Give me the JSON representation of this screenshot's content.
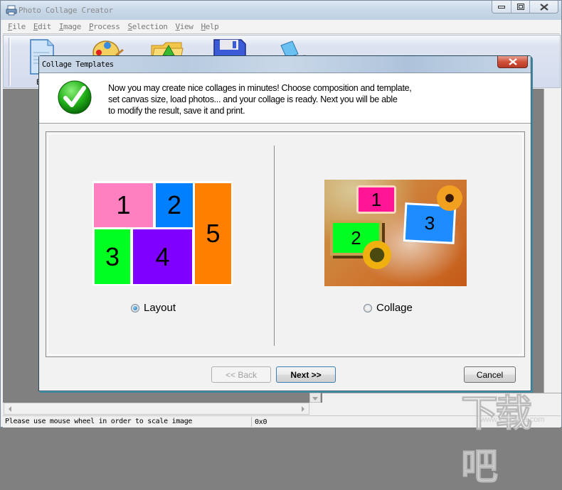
{
  "app": {
    "title": "Photo Collage Creator",
    "window_controls": [
      "minimize",
      "maximize",
      "close"
    ]
  },
  "menubar": {
    "items": [
      {
        "label": "File",
        "accel": "F",
        "rest": "ile"
      },
      {
        "label": "Edit",
        "accel": "E",
        "rest": "dit"
      },
      {
        "label": "Image",
        "accel": "I",
        "rest": "mage"
      },
      {
        "label": "Process",
        "accel": "P",
        "rest": "rocess"
      },
      {
        "label": "Selection",
        "accel": "S",
        "rest": "election"
      },
      {
        "label": "View",
        "accel": "V",
        "rest": "iew"
      },
      {
        "label": "Help",
        "accel": "H",
        "rest": "elp"
      }
    ]
  },
  "toolbar": {
    "buttons": [
      {
        "icon": "new-document-icon",
        "label": "B"
      },
      {
        "icon": "palette-icon",
        "label": ""
      },
      {
        "icon": "open-folder-icon",
        "label": ""
      },
      {
        "icon": "save-disk-icon",
        "label": ""
      },
      {
        "icon": "print-icon",
        "label": ""
      }
    ]
  },
  "dialog": {
    "title": "Collage Templates",
    "header_lines": [
      "Now you may create nice collages in minutes! Choose composition and template,",
      "set canvas size, load photos... and your collage is ready. Next you will be able",
      "to modify the result, save it and print."
    ],
    "options": [
      {
        "label": "Layout",
        "selected": true,
        "cells": [
          {
            "n": "1",
            "color": "#ff80c0"
          },
          {
            "n": "2",
            "color": "#0080ff"
          },
          {
            "n": "3",
            "color": "#00ff20"
          },
          {
            "n": "4",
            "color": "#8000ff"
          },
          {
            "n": "5",
            "color": "#ff8000"
          }
        ]
      },
      {
        "label": "Collage",
        "selected": false,
        "photos": [
          {
            "n": "1",
            "color": "#ff1493"
          },
          {
            "n": "2",
            "color": "#00ff20"
          },
          {
            "n": "3",
            "color": "#1e8cff"
          }
        ]
      }
    ],
    "buttons": {
      "back": "<< Back",
      "next": "Next >>",
      "cancel": "Cancel"
    }
  },
  "statusbar": {
    "message": "Please use mouse wheel in order to scale image",
    "dimensions": "0x0"
  },
  "watermark": {
    "text": "下载吧",
    "url": "www.xiazaiba.com"
  }
}
